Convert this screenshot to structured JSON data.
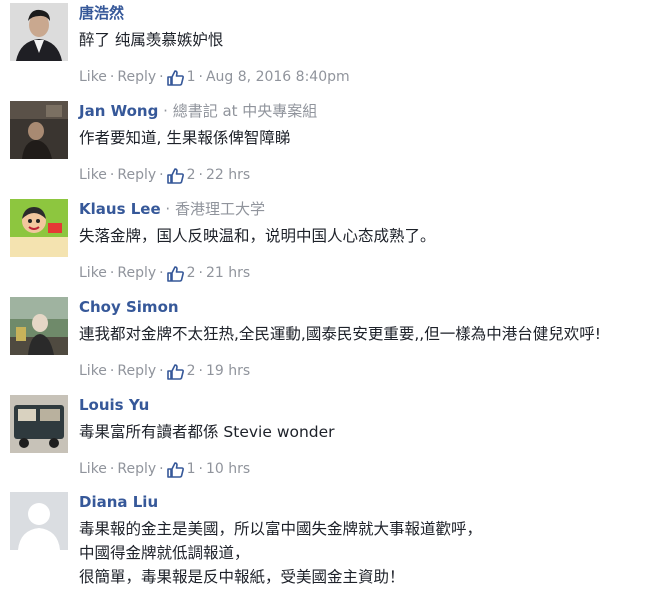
{
  "ui": {
    "like": "Like",
    "reply": "Reply",
    "sep": "·"
  },
  "comments": [
    {
      "name": "唐浩然",
      "affiliation": "",
      "text": [
        "醉了 纯属羡慕嫉妒恨"
      ],
      "likes": "1",
      "time": "Aug 8, 2016 8:40pm",
      "avatar_icon": "profile-photo-man-suit"
    },
    {
      "name": "Jan Wong",
      "affiliation": "總書記 at 中央專案組",
      "text": [
        "作者要知道, 生果報係俾智障睇"
      ],
      "likes": "2",
      "time": "22 hrs",
      "avatar_icon": "profile-photo-dark-room"
    },
    {
      "name": "Klaus Lee",
      "affiliation": "香港理工大学",
      "text": [
        "失落金牌，国人反映温和，说明中国人心态成熟了。"
      ],
      "likes": "2",
      "time": "21 hrs",
      "avatar_icon": "profile-photo-cartoon"
    },
    {
      "name": "Choy Simon",
      "affiliation": "",
      "text": [
        "連我都对金牌不太狂热,全民運動,國泰民安更重要,,但一樣為中港台健兒欢呼!"
      ],
      "likes": "2",
      "time": "19 hrs",
      "avatar_icon": "profile-photo-outdoor"
    },
    {
      "name": "Louis Yu",
      "affiliation": "",
      "text": [
        "毒果富所有讀者都係 Stevie wonder"
      ],
      "likes": "1",
      "time": "10 hrs",
      "avatar_icon": "profile-photo-street"
    },
    {
      "name": "Diana Liu",
      "affiliation": "",
      "text": [
        "毒果報的金主是美國，所以富中國失金牌就大事報道歡呼，",
        "中國得金牌就低調報道，",
        "很簡單，毒果報是反中報紙，受美國金主資助！"
      ],
      "likes": "",
      "time": "",
      "avatar_icon": "default-silhouette"
    }
  ]
}
